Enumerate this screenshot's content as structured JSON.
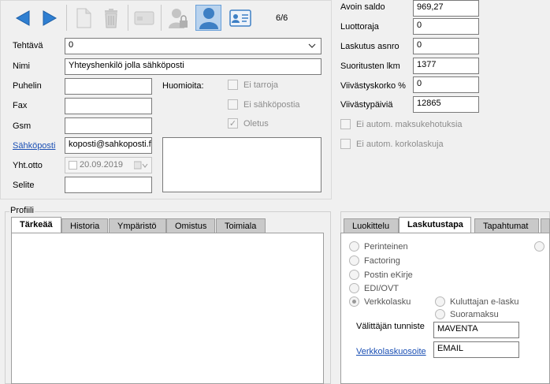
{
  "toolbar": {
    "record_counter": "6/6"
  },
  "form": {
    "tehtava_label": "Tehtävä",
    "tehtava_value": "0",
    "nimi_label": "Nimi",
    "nimi_value": "Yhteyshenkilö jolla sähköposti",
    "puhelin_label": "Puhelin",
    "fax_label": "Fax",
    "gsm_label": "Gsm",
    "sahkoposti_label": "Sähköposti",
    "sahkoposti_value": "koposti@sahkoposti.fi",
    "yhtotto_label": "Yht.otto",
    "yhtotto_value": "20.09.2019",
    "selite_label": "Selite",
    "huomioita_label": "Huomioita:",
    "ei_tarroja_label": "Ei tarroja",
    "ei_sahkopostia_label": "Ei sähköpostia",
    "oletus_label": "Oletus"
  },
  "right_fields": {
    "avoin_saldo_label": "Avoin saldo",
    "avoin_saldo_value": "969,27",
    "luottoraja_label": "Luottoraja",
    "luottoraja_value": "0",
    "laskutus_asnro_label": "Laskutus asnro",
    "laskutus_asnro_value": "0",
    "suoritusten_lkm_label": "Suoritusten lkm",
    "suoritusten_lkm_value": "1377",
    "viivastyskorko_label": "Viivästyskorko %",
    "viivastyskorko_value": "0",
    "viivastyspaivia_label": "Viivästypäiviä",
    "viivastyspaivia_value": "12865",
    "ei_autom_maksukehotuksia": "Ei autom. maksukehotuksia",
    "ei_autom_korkolaskuja": "Ei autom. korkolaskuja"
  },
  "profiili": {
    "title": "Profiili",
    "tabs": [
      "Tärkeää",
      "Historia",
      "Ympäristö",
      "Omistus",
      "Toimiala"
    ]
  },
  "billing": {
    "tabs": [
      "Luokittelu",
      "Laskutustapa",
      "Tapahtumat"
    ],
    "options": {
      "perinteinen": "Perinteinen",
      "factoring": "Factoring",
      "postin_ekirje": "Postin eKirje",
      "edi_ovt": "EDI/OVT",
      "verkkolasku": "Verkkolasku",
      "kuluttajan_elasku": "Kuluttajan e-lasku",
      "suoramaksu": "Suoramaksu"
    },
    "valittajan_tunniste_label": "Välittäjän tunniste",
    "valittajan_tunniste_value": "MAVENTA",
    "verkkolaskuosoite_label": "Verkkolaskuosoite",
    "verkkolaskuosoite_value": "EMAIL"
  }
}
